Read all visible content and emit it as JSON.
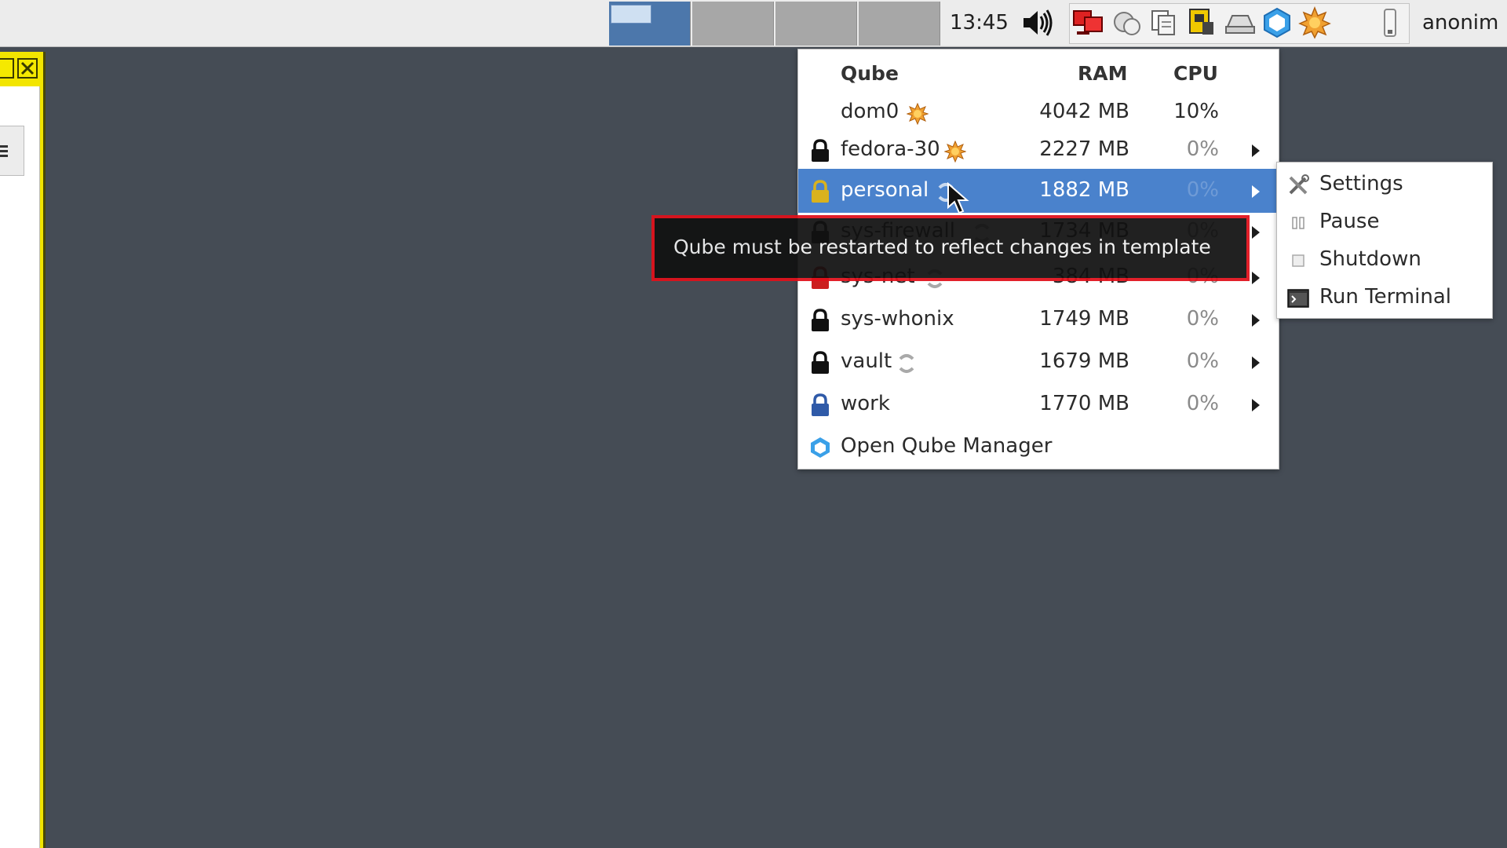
{
  "panel": {
    "workspaces": [
      "workspace-1",
      "workspace-2",
      "workspace-3",
      "workspace-4"
    ],
    "active_workspace": 1,
    "clock": "13:45",
    "user": "anonim",
    "tray_icons": [
      "volume-icon",
      "network-icon",
      "cloud-icon",
      "clipboard-icon",
      "devices-icon",
      "disk-icon",
      "qubes-icon",
      "updates-icon",
      "battery-icon"
    ]
  },
  "qube_menu": {
    "header": {
      "qube": "Qube",
      "ram": "RAM",
      "cpu": "CPU"
    },
    "rows": [
      {
        "name": "dom0",
        "ram": "4042 MB",
        "cpu": "10%",
        "lock_color": "",
        "status": "updates-icon",
        "submenu": false
      },
      {
        "name": "fedora-30",
        "ram": "2227 MB",
        "cpu": "0%",
        "lock_color": "#111111",
        "status": "updates-icon",
        "submenu": true
      },
      {
        "name": "personal",
        "ram": "1882 MB",
        "cpu": "0%",
        "lock_color": "#d9b21e",
        "status": "restart-icon",
        "submenu": true,
        "selected": true
      },
      {
        "name": "sys-firewall",
        "ram": "1734 MB",
        "cpu": "0%",
        "lock_color": "#111111",
        "status": "restart-icon",
        "submenu": true
      },
      {
        "name": "sys-net",
        "ram": "384 MB",
        "cpu": "0%",
        "lock_color": "#cc1f1f",
        "status": "restart-icon",
        "submenu": true
      },
      {
        "name": "sys-whonix",
        "ram": "1749 MB",
        "cpu": "0%",
        "lock_color": "#111111",
        "status": "",
        "submenu": true
      },
      {
        "name": "vault",
        "ram": "1679 MB",
        "cpu": "0%",
        "lock_color": "#111111",
        "status": "restart-icon",
        "submenu": true
      },
      {
        "name": "work",
        "ram": "1770 MB",
        "cpu": "0%",
        "lock_color": "#2f5aa8",
        "status": "",
        "submenu": true
      }
    ],
    "footer": "Open Qube Manager"
  },
  "submenu": {
    "items": [
      {
        "label": "Settings",
        "icon": "settings-icon"
      },
      {
        "label": "Pause",
        "icon": "pause-icon"
      },
      {
        "label": "Shutdown",
        "icon": "shutdown-icon"
      },
      {
        "label": "Run Terminal",
        "icon": "terminal-icon"
      }
    ]
  },
  "tooltip": "Qube must be restarted to reflect changes in template",
  "colors": {
    "desktop": "#454c55",
    "selection": "#4a82cc",
    "tooltip_border": "#e0101a"
  }
}
